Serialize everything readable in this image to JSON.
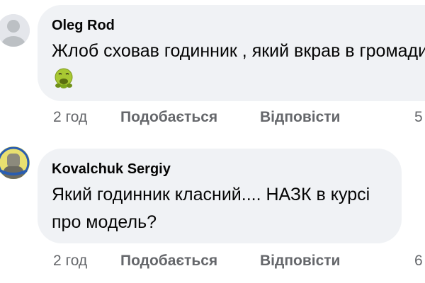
{
  "comments": [
    {
      "author": "Oleg Rod",
      "text": "Жлоб сховав годинник , який вкрав в громади",
      "emoji": "nauseated-face-icon",
      "time": "2 год",
      "like_label": "Подобається",
      "reply_label": "Відповісти",
      "more_label": "5"
    },
    {
      "author": "Kovalchuk Sergiy",
      "text": "Який годинник класний.... НАЗК в курсі про модель?",
      "time": "2 год",
      "like_label": "Подобається",
      "reply_label": "Відповісти",
      "more_label": "6"
    }
  ],
  "colors": {
    "bubble_bg": "#f0f2f5",
    "text": "#050505",
    "secondary_text": "#65676b",
    "default_avatar_bg": "#e4e6eb"
  }
}
